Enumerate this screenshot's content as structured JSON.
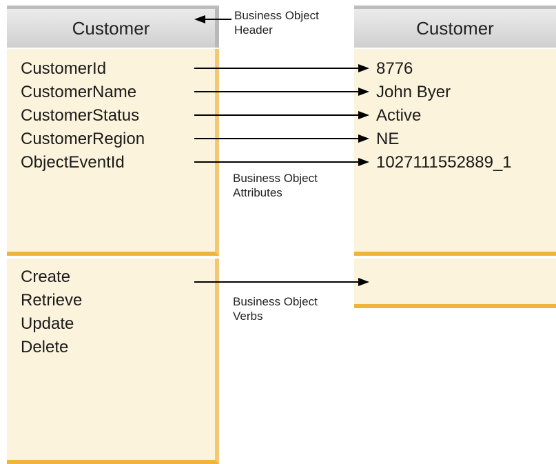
{
  "left_object": {
    "header": "Customer",
    "attributes": [
      "CustomerId",
      "CustomerName",
      "CustomerStatus",
      "CustomerRegion",
      "ObjectEventId"
    ],
    "verbs": [
      "Create",
      "Retrieve",
      "Update",
      "Delete"
    ]
  },
  "right_object": {
    "header": "Customer",
    "attribute_values": [
      "8776",
      "John Byer",
      "Active",
      "NE",
      "1027111552889_1"
    ]
  },
  "captions": {
    "header_line1": "Business Object",
    "header_line2": "Header",
    "attributes_line1": "Business Object",
    "attributes_line2": "Attributes",
    "verbs_line1": "Business Object",
    "verbs_line2": "Verbs"
  },
  "colors": {
    "header_bg": "#dedede",
    "panel_bg": "#fcf3dc",
    "panel_border": "#f0b43a",
    "arrow": "#000000"
  }
}
